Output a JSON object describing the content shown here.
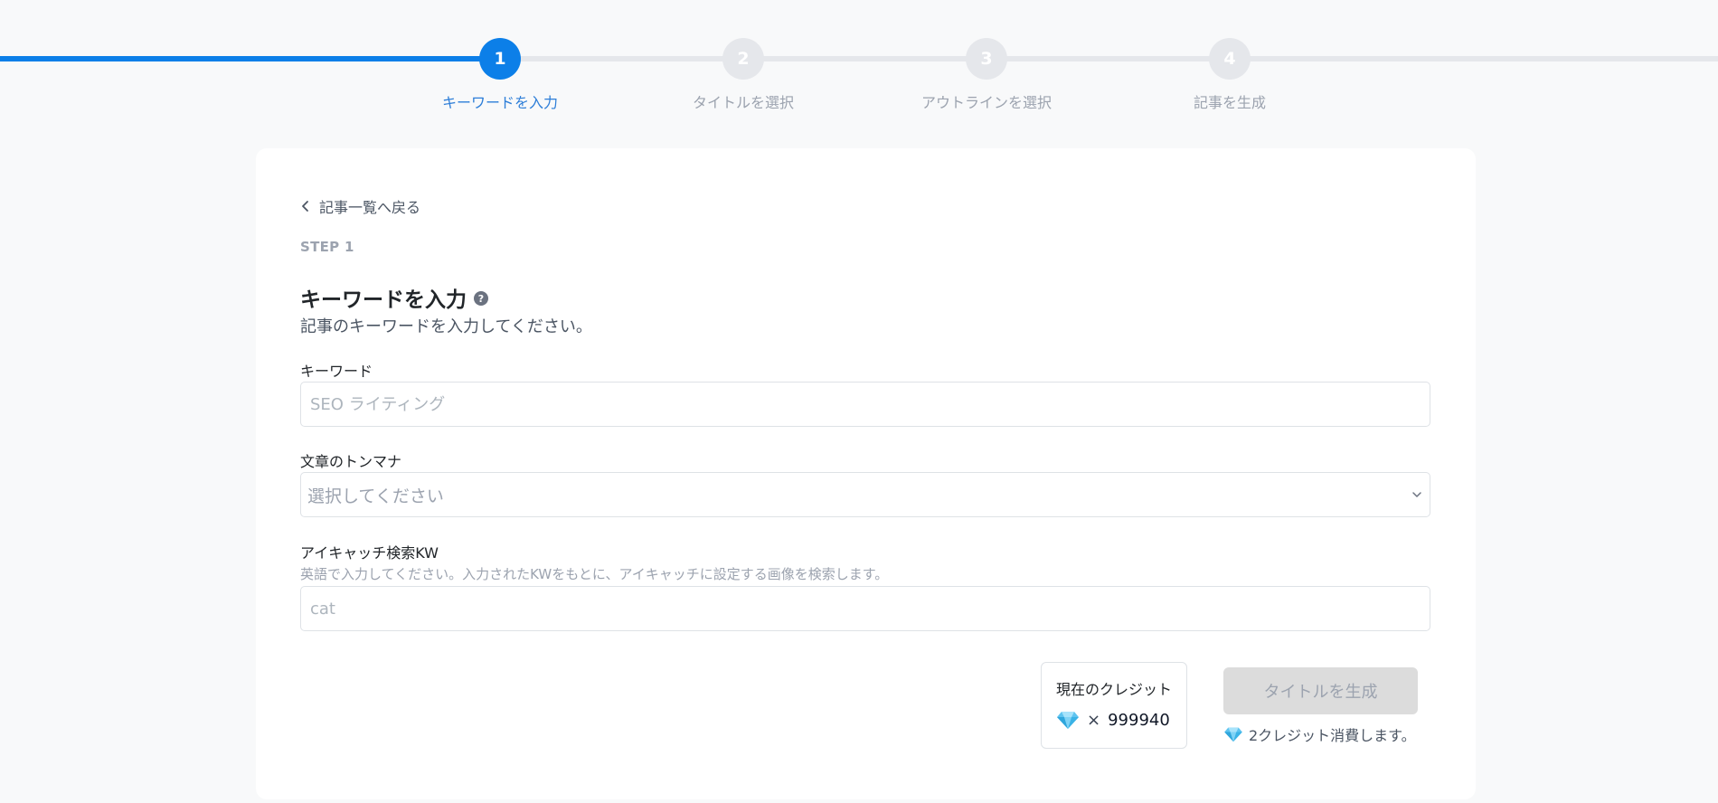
{
  "stepper": {
    "steps": [
      {
        "number": "1",
        "label": "キーワードを入力",
        "state": "active"
      },
      {
        "number": "2",
        "label": "タイトルを選択",
        "state": "inactive"
      },
      {
        "number": "3",
        "label": "アウトラインを選択",
        "state": "inactive"
      },
      {
        "number": "4",
        "label": "記事を生成",
        "state": "inactive"
      }
    ]
  },
  "card": {
    "back_link": "記事一覧へ戻る",
    "step_kicker": "STEP 1",
    "heading": "キーワードを入力",
    "help_icon_glyph": "?",
    "subtitle": "記事のキーワードを入力してください。"
  },
  "form": {
    "keyword": {
      "label": "キーワード",
      "placeholder": "SEO ライティング",
      "value": ""
    },
    "tone": {
      "label": "文章のトンマナ",
      "selected": "選択してください"
    },
    "eyecatch": {
      "label": "アイキャッチ検索KW",
      "help": "英語で入力してください。入力されたKWをもとに、アイキャッチに設定する画像を検索します。",
      "placeholder": "cat",
      "value": ""
    }
  },
  "credits": {
    "title": "現在のクレジット",
    "times": "×",
    "amount": "999940"
  },
  "actions": {
    "generate_label": "タイトルを生成",
    "cost_note": "2クレジット消費します。"
  },
  "colors": {
    "accent": "#0c7fe8",
    "inactive": "#e5e7eb",
    "disabled_button": "#dcdcdc"
  },
  "icons": {
    "back": "chevron-left-icon",
    "help": "question-circle-icon",
    "select": "chevron-down-icon",
    "gem": "gem-icon"
  }
}
